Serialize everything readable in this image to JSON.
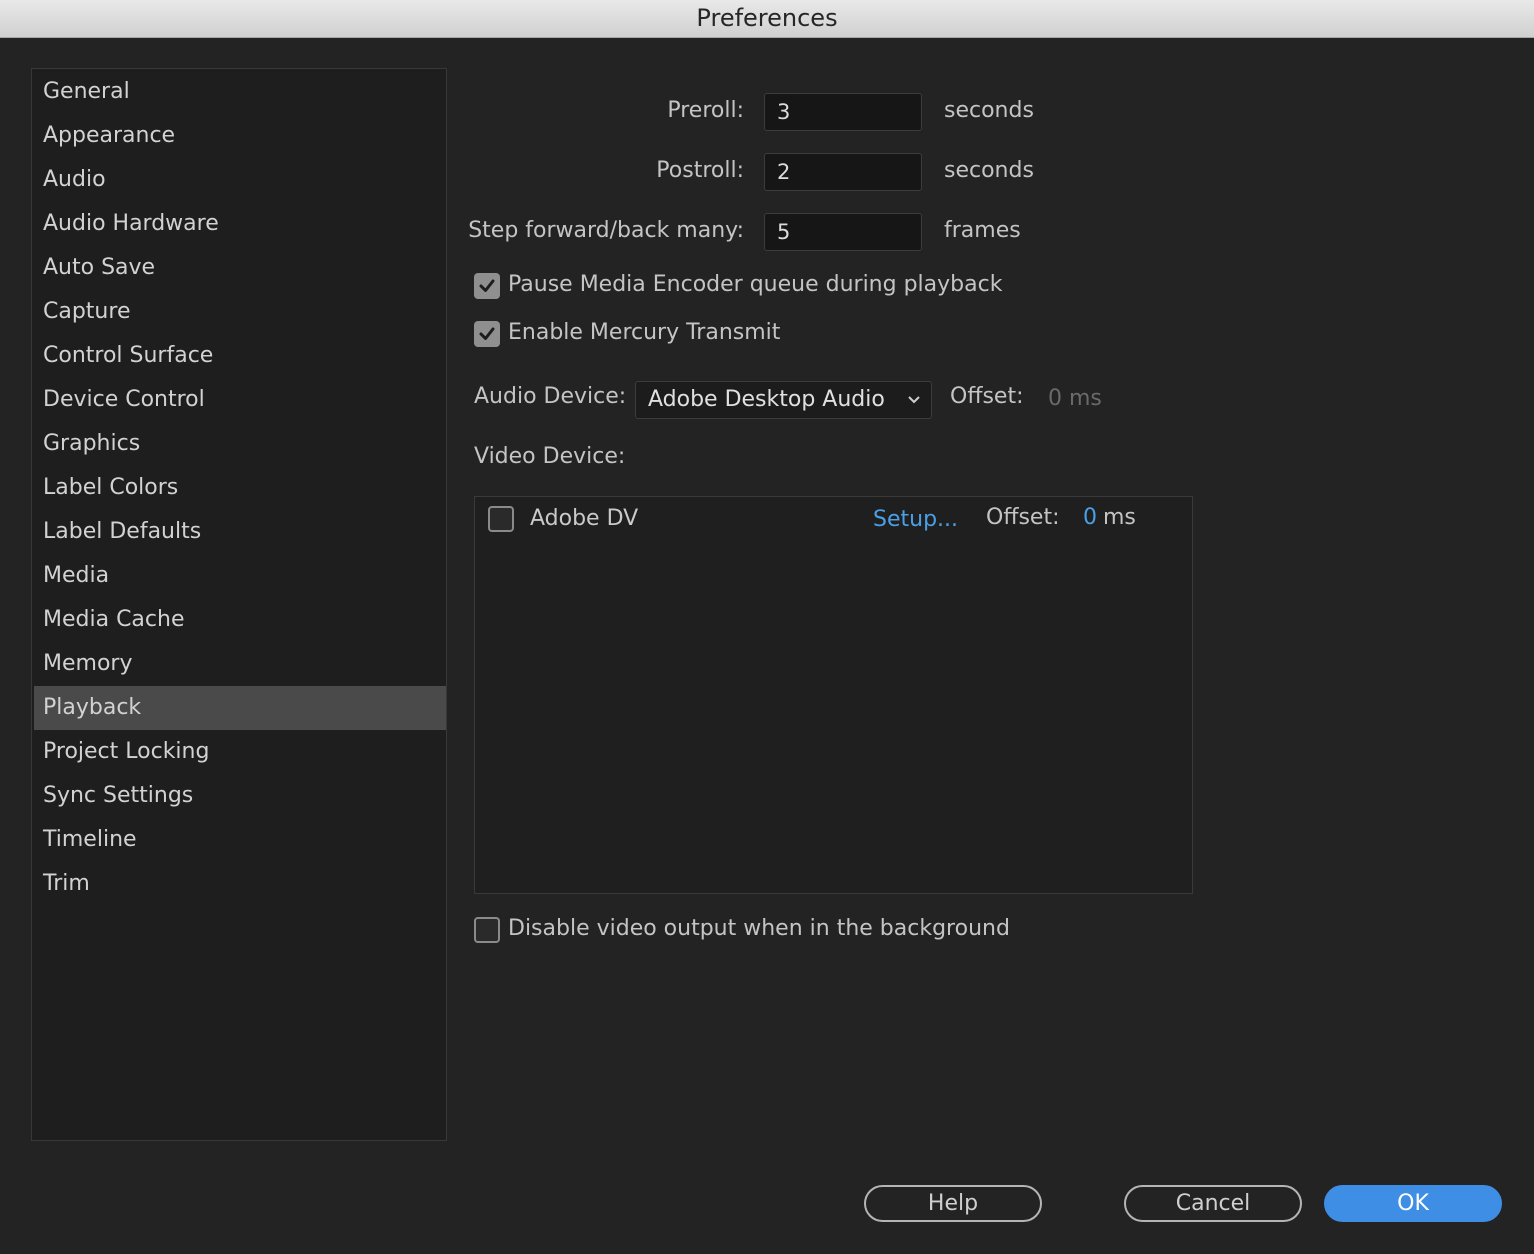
{
  "window": {
    "title": "Preferences"
  },
  "sidebar": {
    "items": [
      {
        "label": "General"
      },
      {
        "label": "Appearance"
      },
      {
        "label": "Audio"
      },
      {
        "label": "Audio Hardware"
      },
      {
        "label": "Auto Save"
      },
      {
        "label": "Capture"
      },
      {
        "label": "Control Surface"
      },
      {
        "label": "Device Control"
      },
      {
        "label": "Graphics"
      },
      {
        "label": "Label Colors"
      },
      {
        "label": "Label Defaults"
      },
      {
        "label": "Media"
      },
      {
        "label": "Media Cache"
      },
      {
        "label": "Memory"
      },
      {
        "label": "Playback",
        "selected": true
      },
      {
        "label": "Project Locking"
      },
      {
        "label": "Sync Settings"
      },
      {
        "label": "Timeline"
      },
      {
        "label": "Trim"
      }
    ]
  },
  "playback": {
    "preroll": {
      "label": "Preroll:",
      "value": "3",
      "unit": "seconds"
    },
    "postroll": {
      "label": "Postroll:",
      "value": "2",
      "unit": "seconds"
    },
    "step": {
      "label": "Step forward/back many:",
      "value": "5",
      "unit": "frames"
    },
    "pause_encoder": {
      "label": "Pause Media Encoder queue during playback",
      "checked": true
    },
    "mercury_transmit": {
      "label": "Enable Mercury Transmit",
      "checked": true
    },
    "audio_device": {
      "label": "Audio Device:",
      "selected": "Adobe Desktop Audio",
      "offset_label": "Offset:",
      "offset_value": "0 ms"
    },
    "video_device": {
      "label": "Video Device:",
      "devices": [
        {
          "name": "Adobe DV",
          "checked": false,
          "setup_label": "Setup...",
          "offset_label": "Offset:",
          "offset_value": "0",
          "offset_unit": "ms"
        }
      ]
    },
    "disable_background": {
      "label": "Disable video output when in the background",
      "checked": false
    }
  },
  "buttons": {
    "help": "Help",
    "cancel": "Cancel",
    "ok": "OK"
  },
  "colors": {
    "accent": "#3d8ee4",
    "link": "#4a9fe8",
    "selected_row": "#4a4a4a"
  }
}
